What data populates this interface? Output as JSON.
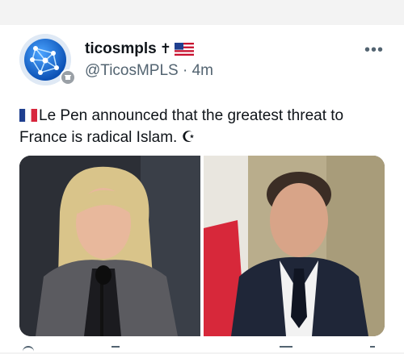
{
  "post": {
    "display_name": "ticosmpls",
    "name_suffix_glyph": "✝",
    "handle": "@TicosMPLS",
    "separator": " · ",
    "time": "4m",
    "more_glyph": "•••",
    "text_main": "Le Pen announced that the greatest threat to France is radical Islam. ",
    "text_end_glyph": "☪"
  },
  "media": {
    "left_image": "photo-le-pen-speaking-at-microphone",
    "right_image": "photo-macron-in-suit"
  },
  "colors": {
    "name": "#0f1419",
    "secondary": "#536471",
    "background": "#f3f3f3",
    "card": "#ffffff"
  }
}
